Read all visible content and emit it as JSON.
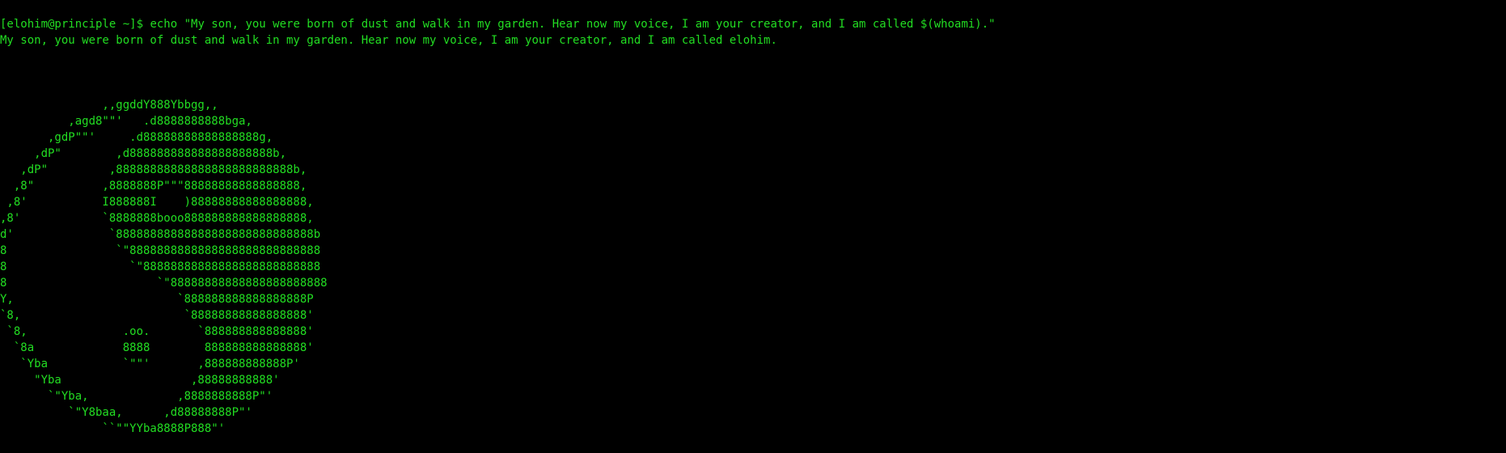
{
  "colors": {
    "background": "#000000",
    "text": "#22dd22"
  },
  "terminal": {
    "prompt": "[elohim@principle ~]$ ",
    "command": "echo \"My son, you were born of dust and walk in my garden. Hear now my voice, I am your creator, and I am called $(whoami).\"",
    "output": "My son, you were born of dust and walk in my garden. Hear now my voice, I am your creator, and I am called elohim.",
    "art": [
      "               ,,ggddY888Ybbgg,,",
      "          ,agd8\"\"'   .d8888888888bga,",
      "       ,gdP\"\"'     .d88888888888888888g,",
      "     ,dP\"        ,d888888888888888888888b,",
      "   ,dP\"         ,88888888888888888888888888b,",
      "  ,8\"          ,8888888P\"\"\"88888888888888888,",
      " ,8'           I888888I    )88888888888888888,",
      ",8'            `8888888booo888888888888888888,",
      "d'              `88888888888888888888888888888b",
      "8                `\"8888888888888888888888888888",
      "8                  `\"88888888888888888888888888",
      "8                      `\"88888888888888888888888",
      "Y,                        `888888888888888888P",
      "`8,                        `88888888888888888'",
      " `8,              .oo.       `888888888888888'",
      "  `8a             8888        888888888888888'",
      "   `Yba           `\"\"'       ,888888888888P'",
      "     \"Yba                   ,88888888888'",
      "       `\"Yba,             ,8888888888P\"'",
      "          `\"Y8baa,      ,d88888888P\"'",
      "               ``\"\"YYba8888P888\"'"
    ]
  }
}
